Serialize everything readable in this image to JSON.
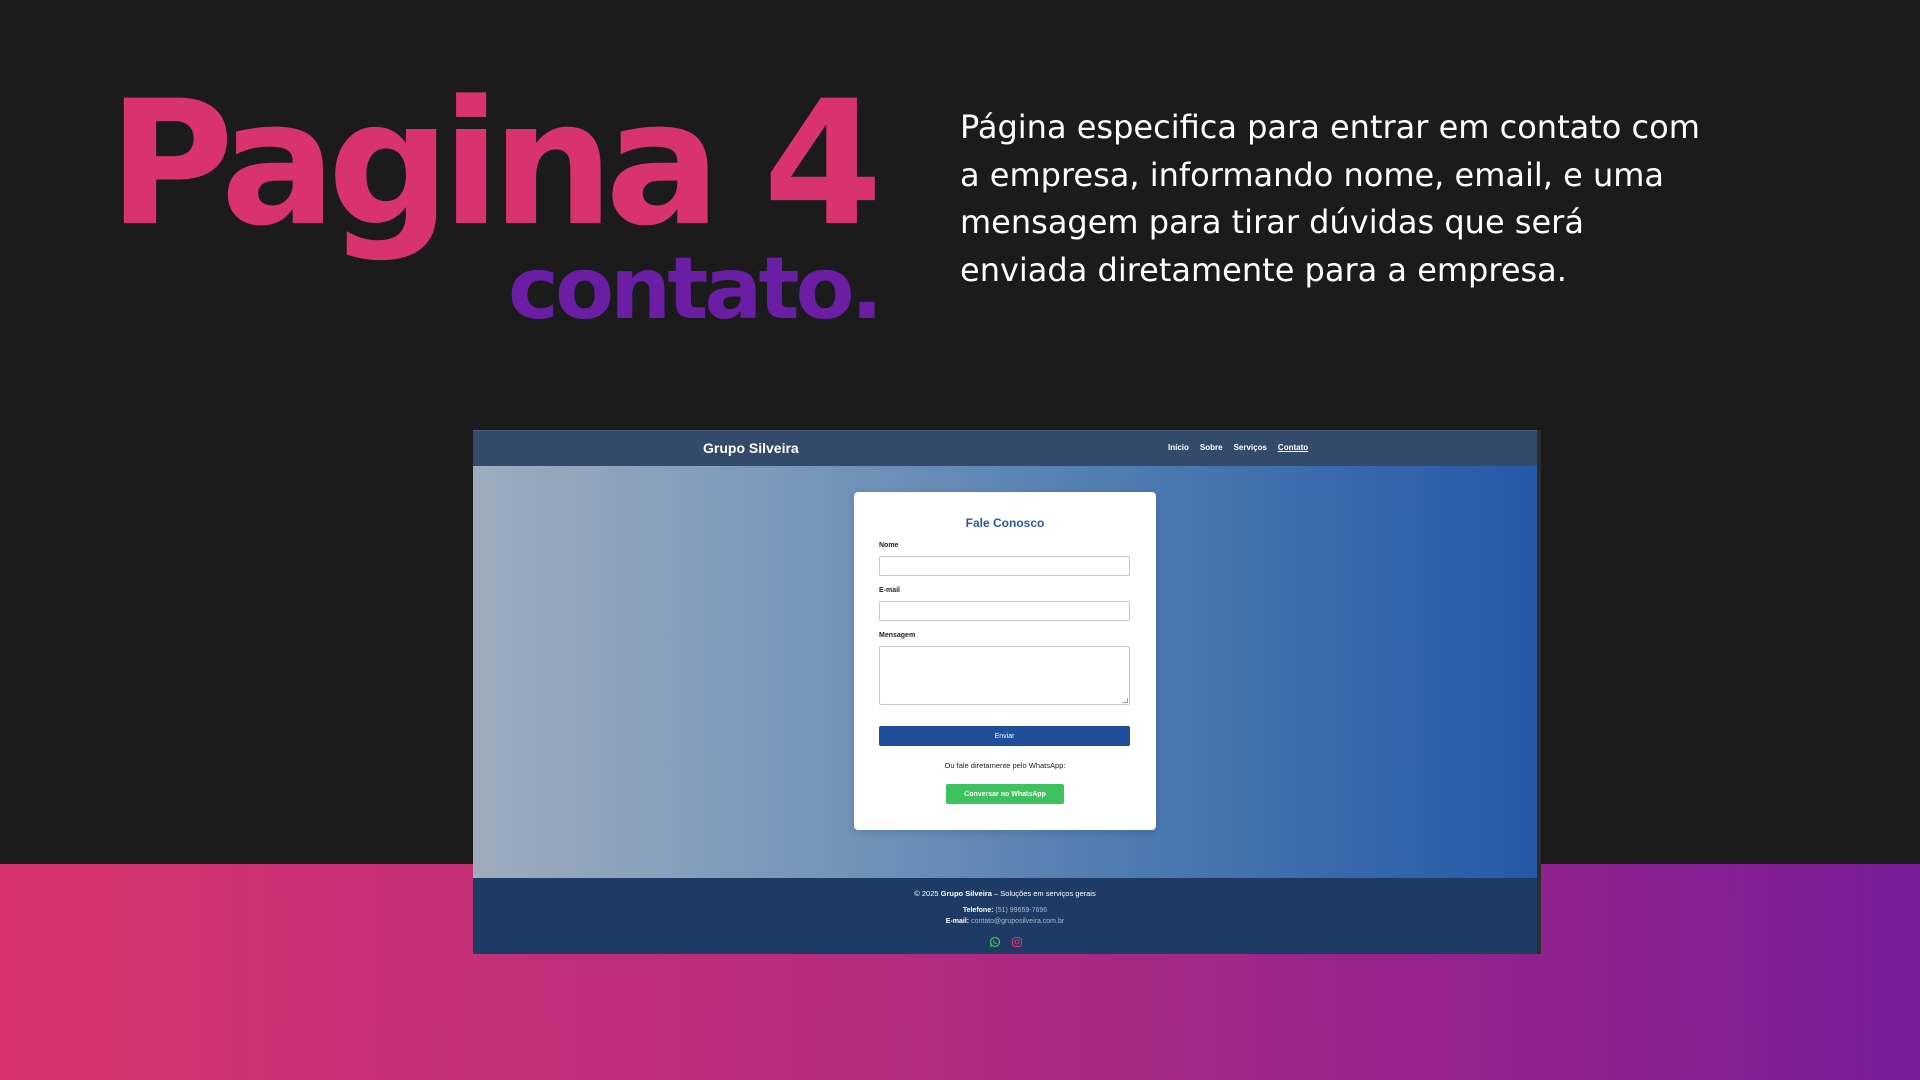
{
  "slide": {
    "title": "Pagina 4",
    "subtitle": "contato.",
    "description": "Página especifica para entrar em contato com a empresa, informando nome, email, e uma mensagem para tirar dúvidas que será enviada diretamente para a empresa.",
    "colors": {
      "title": "#d8336f",
      "subtitle": "#6a1ea3",
      "background": "#1b1b1c"
    }
  },
  "site": {
    "brand": "Grupo Silveira",
    "nav": [
      {
        "label": "Início"
      },
      {
        "label": "Sobre"
      },
      {
        "label": "Serviços"
      },
      {
        "label": "Contato",
        "active": true
      }
    ],
    "form": {
      "title": "Fale Conosco",
      "name_label": "Nome",
      "name_value": "",
      "email_label": "E-mail",
      "email_value": "",
      "message_label": "Mensagem",
      "message_value": "",
      "submit_label": "Enviar",
      "whatsapp_note": "Ou fale diretamente pelo WhatsApp:",
      "whatsapp_button": "Conversar no WhatsApp"
    },
    "footer": {
      "copyright_prefix": "© 2025",
      "company": "Grupo Silveira",
      "tagline": "– Soluções em serviços gerais",
      "phone_label": "Telefone:",
      "phone": "(51) 99659-7696",
      "email_label": "E-mail:",
      "email": "contato@gruposilveira.com.br",
      "icons": [
        "whatsapp-icon",
        "instagram-icon"
      ]
    }
  }
}
